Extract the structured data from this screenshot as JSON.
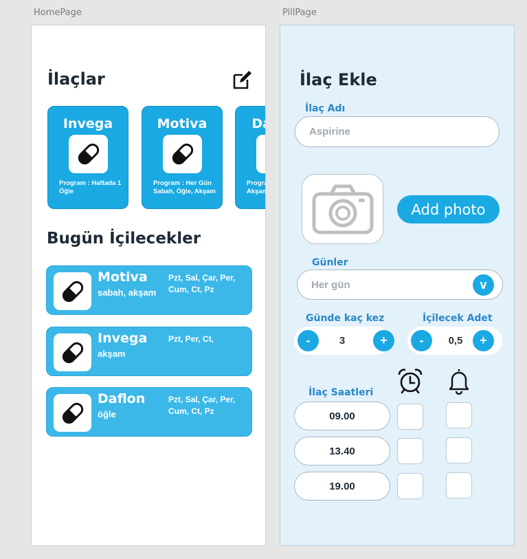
{
  "frames": {
    "home_label": "HomePage",
    "pill_label": "PillPage"
  },
  "home": {
    "title": "İlaçlar",
    "edit_icon": "edit-icon",
    "medicines": [
      {
        "name": "Invega",
        "program": "Program : Haftada 1 Öğle"
      },
      {
        "name": "Motiva",
        "program": "Program : Her Gün Sabah, Öğle, Akşam"
      },
      {
        "name": "Daflon",
        "program": "Program : Her Gün Akşam"
      }
    ],
    "today_title": "Bugün İçilecekler",
    "today": [
      {
        "name": "Motiva",
        "time": "sabah, akşam",
        "days": "Pzt, Sal, Çar, Per, Cum, Ct, Pz"
      },
      {
        "name": "Invega",
        "time": "akşam",
        "days": "Pzt, Per, Ct,"
      },
      {
        "name": "Daflon",
        "time": "öğle",
        "days": "Pzt, Sal, Çar, Per, Cum, Ct, Pz"
      }
    ],
    "pill_icon": "pill-icon"
  },
  "pill": {
    "title": "İlaç Ekle",
    "name_label": "İlaç Adı",
    "name_placeholder": "Aspirine",
    "add_photo": "Add photo",
    "camera_icon": "camera-icon",
    "days_label": "Günler",
    "days_value": "Her gün",
    "days_toggle": "v",
    "per_day_label": "Günde kaç kez",
    "per_day_value": "3",
    "amount_label": "İçilecek Adet",
    "amount_value": "0,5",
    "minus": "-",
    "plus": "+",
    "times_label": "İlaç Saatleri",
    "alarm_icon": "alarm-clock-icon",
    "bell_icon": "bell-icon",
    "times": [
      "09.00",
      "13.40",
      "19.00"
    ]
  },
  "colors": {
    "accent": "#1aa9e2",
    "accent_light": "#3bb8e8",
    "pill_bg": "#e3f1fb",
    "label_blue": "#2b88c6"
  }
}
